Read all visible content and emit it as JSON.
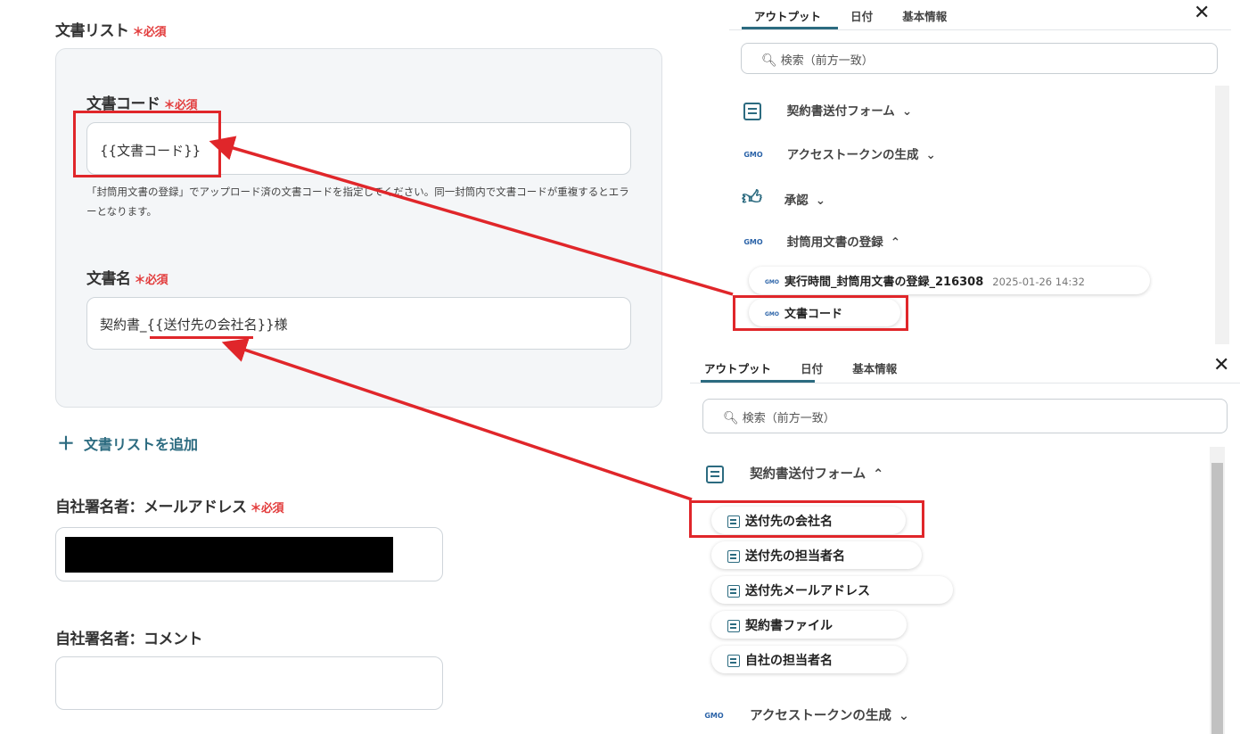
{
  "form": {
    "doc_list_label": "文書リスト",
    "required": "＊必須",
    "doc_code_label": "文書コード",
    "doc_code_value": "{{文書コード}}",
    "doc_code_help": "「封筒用文書の登録」でアップロード済の文書コードを指定してください。同一封筒内で文書コードが重複するとエラーとなります。",
    "doc_name_label": "文書名",
    "doc_name_value": "契約書_{{送付先の会社名}}様",
    "add_doc_list": "文書リストを追加",
    "add_icon": "plus-icon",
    "signer_email_label": "自社署名者：メールアドレス",
    "signer_comment_label": "自社署名者：コメント",
    "signer_comment_value": ""
  },
  "panel_top": {
    "tabs": [
      "アウトプット",
      "日付",
      "基本情報"
    ],
    "active_tab": "アウトプット",
    "close_icon": "close-icon",
    "search_placeholder": "検索（前方一致）",
    "sections": [
      {
        "label": "契約書送付フォーム",
        "icon": "form-icon",
        "expanded": false
      },
      {
        "label": "アクセストークンの生成",
        "icon": "gmo-sign-icon",
        "expanded": false
      },
      {
        "label": "承認",
        "icon": "thumbs-up-icon",
        "expanded": false
      },
      {
        "label": "封筒用文書の登録",
        "icon": "gmo-sign-icon",
        "expanded": true
      }
    ],
    "exec_chip": {
      "label": "実行時間_封筒用文書の登録_216308",
      "timestamp": "2025-01-26 14:32"
    },
    "doc_code_chip": "文書コード"
  },
  "panel_bottom": {
    "tabs": [
      "アウトプット",
      "日付",
      "基本情報"
    ],
    "active_tab": "アウトプット",
    "search_placeholder": "検索（前方一致）",
    "form_section": "契約書送付フォーム",
    "chips": [
      "送付先の会社名",
      "送付先の担当者名",
      "送付先メールアドレス",
      "契約書ファイル",
      "自社の担当者名"
    ],
    "token_section": "アクセストークンの生成"
  },
  "colors": {
    "accent": "#2c6b80",
    "required": "#e23b3b",
    "annotation": "#e0262a"
  }
}
